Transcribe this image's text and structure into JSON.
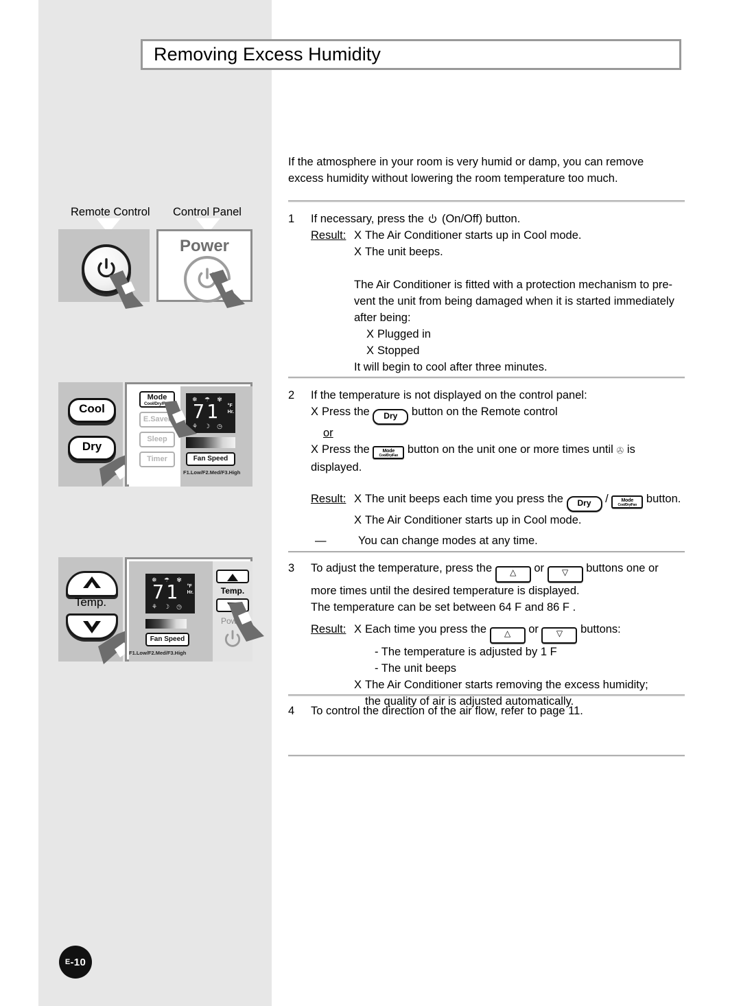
{
  "page": {
    "title": "Removing Excess Humidity",
    "page_number": "E-10",
    "page_number_prefix": "E",
    "page_number_suffix": "-10"
  },
  "intro": {
    "line1": "If the atmosphere in your room is very humid or damp, you can remove",
    "line2": "excess humidity without lowering the room temperature too much."
  },
  "figures": {
    "label_remote": "Remote Control",
    "label_control_panel": "Control Panel",
    "power_word": "Power",
    "remote_cool": "Cool",
    "remote_dry": "Dry",
    "remote_temp": "Temp.",
    "unit_mode_main": "Mode",
    "unit_mode_sub": "Cool/Dry/Fan",
    "unit_esaver": "E.Saver",
    "unit_sleep": "Sleep",
    "unit_timer": "Timer",
    "unit_fanspeed": "Fan Speed",
    "unit_fan_legend": "F1.Low/F2.Med/F3.High",
    "unit_temp": "Temp.",
    "unit_power": "Power",
    "lcd_value": "71",
    "lcd_unit_f": "°F",
    "lcd_unit_hr": "Hr."
  },
  "steps": [
    {
      "num": "1",
      "lead_a": "If necessary, press the",
      "lead_b": "(On/Off) button.",
      "result_label": "Result:",
      "results": [
        "The Air Conditioner starts up in Cool mode.",
        "The unit beeps."
      ],
      "note_lines": [
        "The Air Conditioner is fitted with a protection mechanism to pre-",
        "vent the unit from being damaged when it is started immediately",
        "after being:"
      ],
      "note_bullets": [
        "Plugged in",
        "Stopped"
      ],
      "note_tail": "It will begin to cool after three minutes."
    },
    {
      "num": "2",
      "lead": "If the temperature is not displayed on the control panel:",
      "b1_a": "Press the",
      "b1_b": "button on the Remote control",
      "or": "or",
      "b2_a": "Press the",
      "b2_b": "button on the unit one or more times until",
      "b2_c": "is displayed.",
      "result_label": "Result:",
      "r1_a": "The unit beeps each time you press the",
      "r1_sep": "/",
      "r1_b": "button.",
      "r2": "The Air Conditioner starts up in Cool mode.",
      "dash": "—",
      "note": "You can change modes at any time."
    },
    {
      "num": "3",
      "lead_a": "To adjust the temperature, press the",
      "lead_or": "or",
      "lead_b": "buttons one or",
      "line2": "more times until the desired temperature is displayed.",
      "line3": "The temperature can be set between 64 F and 86 F .",
      "result_label": "Result:",
      "r1_a": "Each time you press the",
      "r1_or": "or",
      "r1_b": "buttons:",
      "sub1": "- The temperature is adjusted by 1 F",
      "sub2": "- The unit beeps",
      "r2_line1": "The Air Conditioner starts removing the excess humidity;",
      "r2_line2": "the quality of air is adjusted automatically."
    },
    {
      "num": "4",
      "lead": "To control the direction of the air flow, refer to page 11."
    }
  ],
  "glyphs": {
    "bullet": "X",
    "key_dry": "Dry",
    "key_mode_main": "Mode",
    "key_mode_sub": "Cool/Dry/Fan",
    "key_up": "△",
    "key_down": "▽",
    "dry_symbol": "✇"
  },
  "colors": {
    "band": "#e7e7e7",
    "panel_gray": "#c4c4c4",
    "panel_border": "#8d8d8d",
    "lcd": "#1c1c1c",
    "power_word": "#6e6e6e",
    "cursor": "#6d6d6d"
  }
}
